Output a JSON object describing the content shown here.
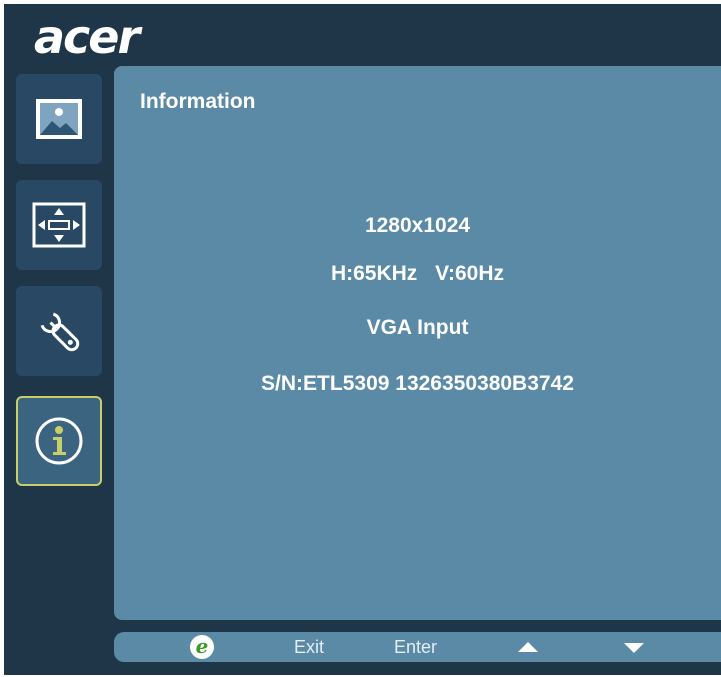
{
  "brand": {
    "logo_text": "acer"
  },
  "sidebar": {
    "tabs": [
      {
        "id": "picture",
        "icon": "picture-icon",
        "active": false
      },
      {
        "id": "osd",
        "icon": "position-arrows-icon",
        "active": false
      },
      {
        "id": "setting",
        "icon": "wrench-icon",
        "active": false
      },
      {
        "id": "information",
        "icon": "info-icon",
        "active": true
      }
    ]
  },
  "panel": {
    "title": "Information",
    "resolution": "1280x1024",
    "h_freq": "H:65KHz",
    "v_freq": "V:60Hz",
    "input": "VGA Input",
    "serial": "S/N:ETL5309 1326350380B3742"
  },
  "footer": {
    "eco_icon_glyph": "e",
    "exit_label": "Exit",
    "enter_label": "Enter",
    "up_icon": "triangle-up-icon",
    "down_icon": "triangle-down-icon"
  },
  "colors": {
    "background": "#1f3649",
    "panel": "#5a8aa6",
    "active_border": "#c8cf6a"
  }
}
